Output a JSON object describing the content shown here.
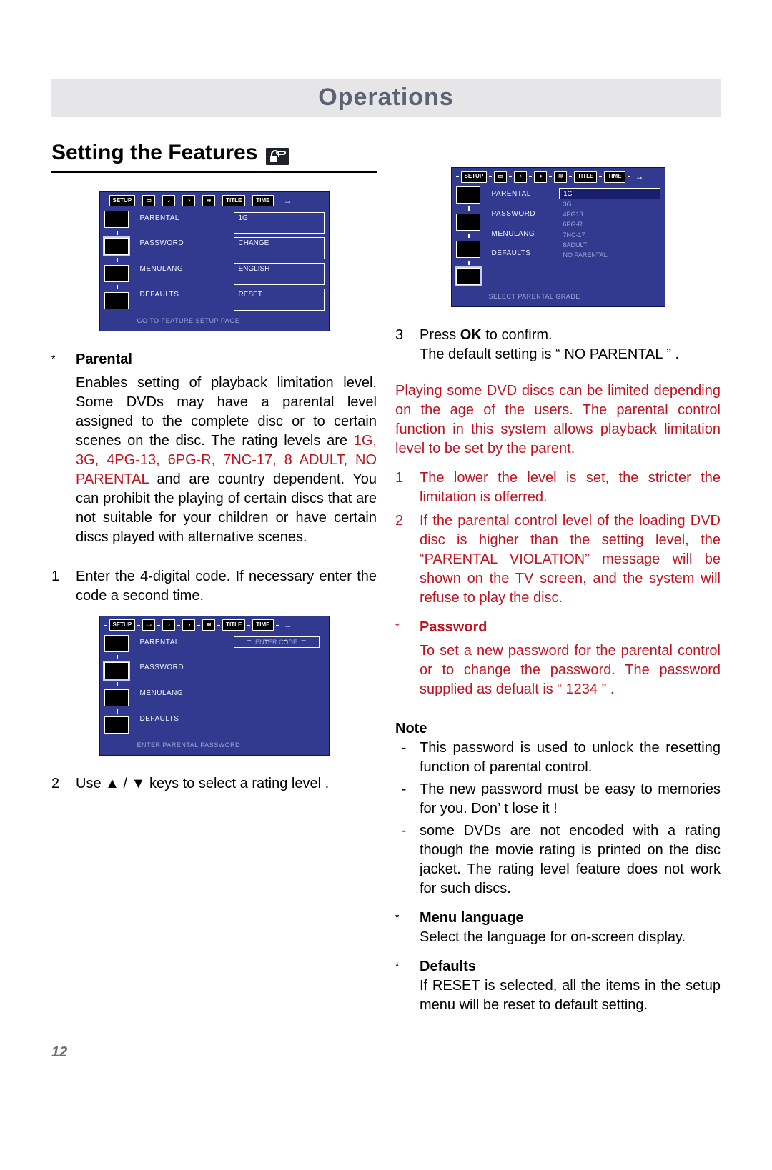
{
  "banner_title": "Operations",
  "section_title": "Setting the Features",
  "tabbar": {
    "setup": "SETUP",
    "title": "TITLE",
    "time": "TIME"
  },
  "screens": {
    "feature": {
      "rows": {
        "parental_label": "PARENTAL",
        "parental_val": "1G",
        "password_label": "PASSWORD",
        "password_val": "CHANGE",
        "menulang_label": "MENULANG",
        "menulang_val": "ENGLISH",
        "defaults_label": "DEFAULTS",
        "defaults_val": "RESET"
      },
      "footer": "GO TO FEATURE SETUP PAGE"
    },
    "password": {
      "rows": {
        "parental_label": "PARENTAL",
        "password_label": "PASSWORD",
        "menulang_label": "MENULANG",
        "defaults_label": "DEFAULTS"
      },
      "enter_code": "ENTER CODE",
      "footer": "ENTER PARENTAL PASSWORD"
    },
    "grade": {
      "labels": {
        "parental_label": "PARENTAL",
        "password_label": "PASSWORD",
        "menulang_label": "MENULANG",
        "defaults_label": "DEFAULTS"
      },
      "grades": [
        "1G",
        "3G",
        "4PG13",
        "6PG-R",
        "7NC-17",
        "8ADULT",
        "NO PARENTAL"
      ],
      "footer": "SELECT PARENTAL GRADE"
    }
  },
  "left": {
    "bullet1_title": "Parental",
    "bullet1_body_1": "Enables setting of playback limitation level. Some DVDs may have a parental level assigned to the complete disc or to certain scenes on the disc. The rating levels are ",
    "bullet1_body_red": "1G, 3G, 4PG-13, 6PG-R, 7NC-17, 8 ADULT, NO PARENTAL",
    "bullet1_body_2": " and are country dependent. You can prohibit the playing of certain discs that are not suitable for your children or have certain discs played with alternative scenes.",
    "step1_num": "1",
    "step1_text": "Enter the  4-digital code. If necessary enter the code a second time.",
    "step2_num": "2",
    "step2_text_a": "Use ",
    "step2_text_b": " keys to select a rating level ."
  },
  "right": {
    "step3_num": "3",
    "step3_line1_a": "Press ",
    "step3_line1_b": "OK",
    "step3_line1_c": " to confirm.",
    "step3_line2": "The default setting is “ NO PARENTAL ” .",
    "red_intro": "Playing some DVD discs can be limited depending on the age of the users. The parental control function in this system allows playback limitation level to be set by the parent.",
    "red1_num": "1",
    "red1_text": "The lower the level is set, the stricter the limitation is offerred.",
    "red2_num": "2",
    "red2_text": "If the parental control level of the loading DVD disc is higher than the setting level, the “PARENTAL VIOLATION” message will be shown on the TV screen, and the system will refuse to play the disc.",
    "pw_title": "Password",
    "pw_body": "To  set a new password for the parental control or to change the password. The password supplied as defualt is “ 1234 ” .",
    "note_title": "Note",
    "note1": "This password is used to unlock the resetting function of parental control.",
    "note2": "The new password must be easy to memories for you. Don’ t lose it !",
    "note3": "some DVDs are not encoded with a rating though the movie rating is printed on the disc jacket. The rating level feature does not work for such discs.",
    "menu_title": "Menu  language",
    "menu_body": "Select the language for on-screen display.",
    "def_title": "Defaults",
    "def_body": "If RESET is selected, all the items in the setup menu will be reset to default setting."
  },
  "glyph_up": "▲",
  "glyph_down": "▼",
  "page_number": "12"
}
